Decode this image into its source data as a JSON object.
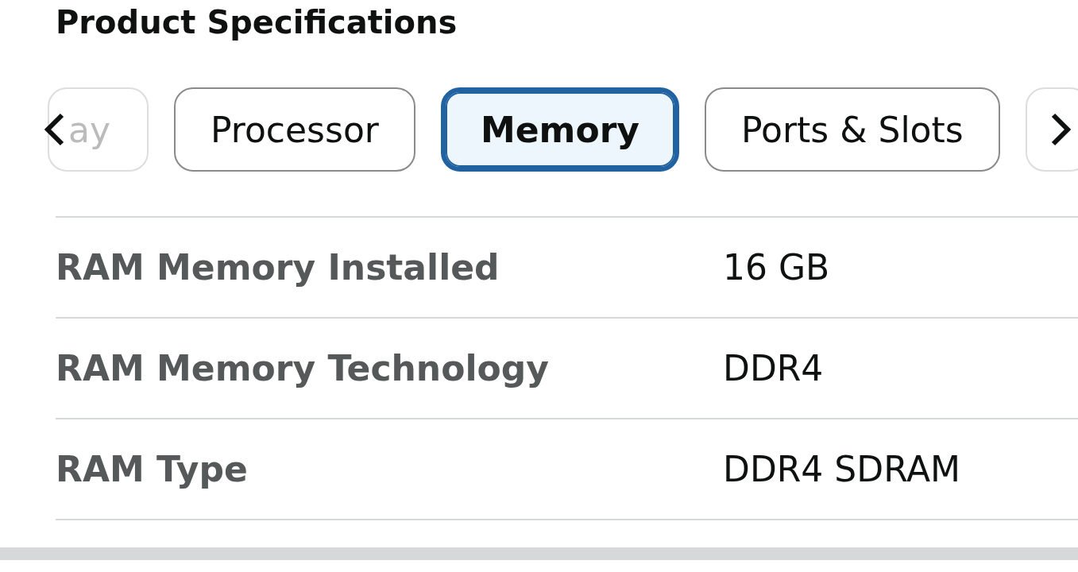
{
  "heading": "Product Specifications",
  "tabs": [
    {
      "label": "ay",
      "selected": false,
      "partial": true
    },
    {
      "label": "Processor",
      "selected": false,
      "partial": false
    },
    {
      "label": "Memory",
      "selected": true,
      "partial": false
    },
    {
      "label": "Ports & Slots",
      "selected": false,
      "partial": false
    },
    {
      "selected": false,
      "partial": true
    }
  ],
  "rows": [
    {
      "name": "RAM Memory Installed",
      "value": "16 GB"
    },
    {
      "name": "RAM Memory Technology",
      "value": "DDR4"
    },
    {
      "name": "RAM Type",
      "value": "DDR4 SDRAM"
    }
  ]
}
